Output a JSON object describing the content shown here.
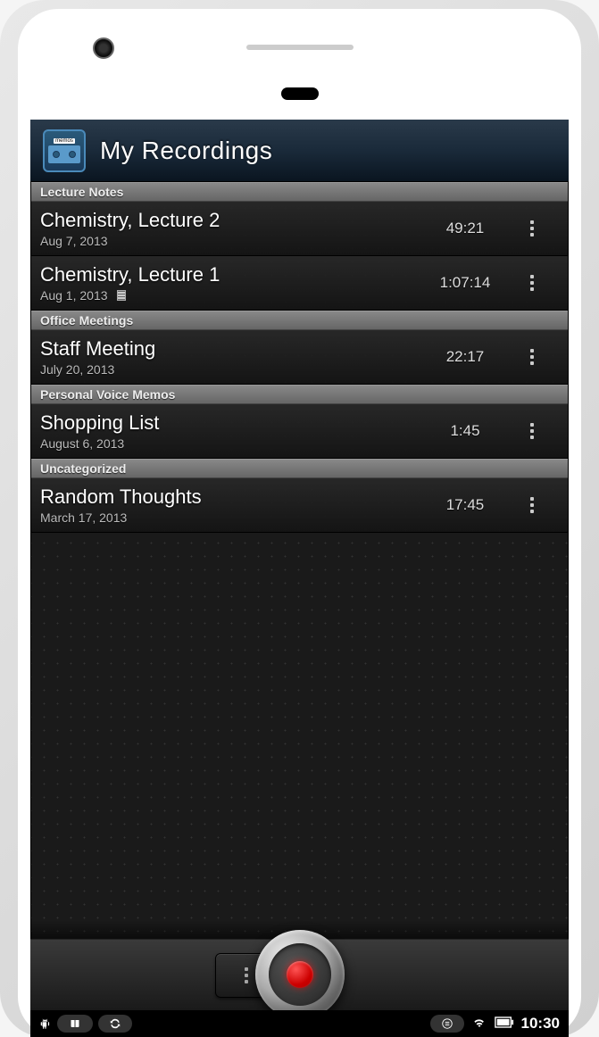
{
  "app_icon_label": "memos",
  "header": {
    "title": "My Recordings"
  },
  "sections": [
    {
      "name": "Lecture Notes",
      "items": [
        {
          "title": "Chemistry, Lecture 2",
          "date": "Aug 7, 2013",
          "duration": "49:21",
          "has_note": false
        },
        {
          "title": "Chemistry, Lecture 1",
          "date": "Aug 1, 2013",
          "duration": "1:07:14",
          "has_note": true
        }
      ]
    },
    {
      "name": "Office Meetings",
      "items": [
        {
          "title": "Staff Meeting",
          "date": "July 20, 2013",
          "duration": "22:17",
          "has_note": false
        }
      ]
    },
    {
      "name": "Personal Voice Memos",
      "items": [
        {
          "title": "Shopping List",
          "date": "August 6, 2013",
          "duration": "1:45",
          "has_note": false
        }
      ]
    },
    {
      "name": "Uncategorized",
      "items": [
        {
          "title": "Random Thoughts",
          "date": "March 17, 2013",
          "duration": "17:45",
          "has_note": false
        }
      ]
    }
  ],
  "statusbar": {
    "time": "10:30"
  }
}
